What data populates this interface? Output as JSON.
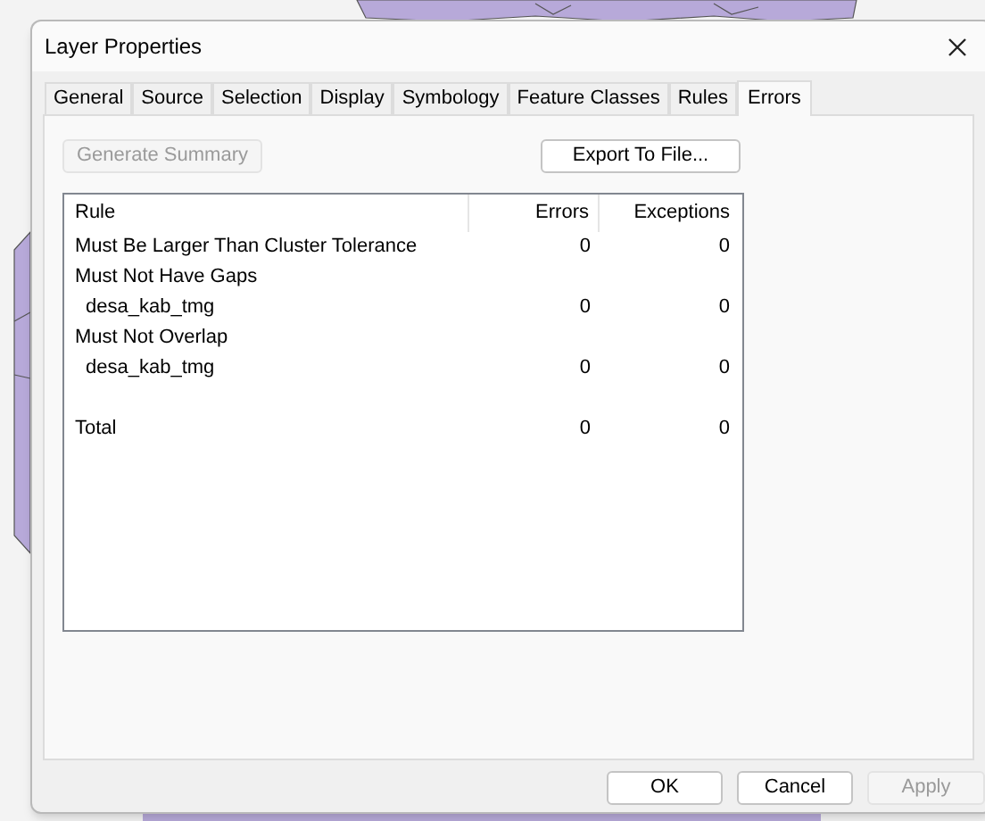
{
  "window": {
    "title": "Layer Properties"
  },
  "tabs": [
    {
      "label": "General",
      "selected": false
    },
    {
      "label": "Source",
      "selected": false
    },
    {
      "label": "Selection",
      "selected": false
    },
    {
      "label": "Display",
      "selected": false
    },
    {
      "label": "Symbology",
      "selected": false
    },
    {
      "label": "Feature Classes",
      "selected": false
    },
    {
      "label": "Rules",
      "selected": false
    },
    {
      "label": "Errors",
      "selected": true
    }
  ],
  "toolbar": [
    {
      "label": "Generate Summary",
      "disabled": true
    },
    {
      "label": "Export To File...",
      "disabled": false
    }
  ],
  "table": {
    "columns": [
      "Rule",
      "Errors",
      "Exceptions"
    ],
    "rows": [
      {
        "kind": "rule",
        "rule": "Must Be Larger Than Cluster Tolerance",
        "errors": "0",
        "exceptions": "0"
      },
      {
        "kind": "rule",
        "rule": "Must Not Have Gaps"
      },
      {
        "kind": "feature_class",
        "rule": "desa_kab_tmg",
        "errors": "0",
        "exceptions": "0"
      },
      {
        "kind": "rule",
        "rule": "Must Not Overlap"
      },
      {
        "kind": "feature_class",
        "rule": "desa_kab_tmg",
        "errors": "0",
        "exceptions": "0"
      }
    ],
    "total": {
      "rule": "Total",
      "errors": "0",
      "exceptions": "0"
    }
  },
  "buttons": [
    {
      "label": "OK",
      "disabled": false
    },
    {
      "label": "Cancel",
      "disabled": false
    },
    {
      "label": "Apply",
      "disabled": true
    }
  ]
}
